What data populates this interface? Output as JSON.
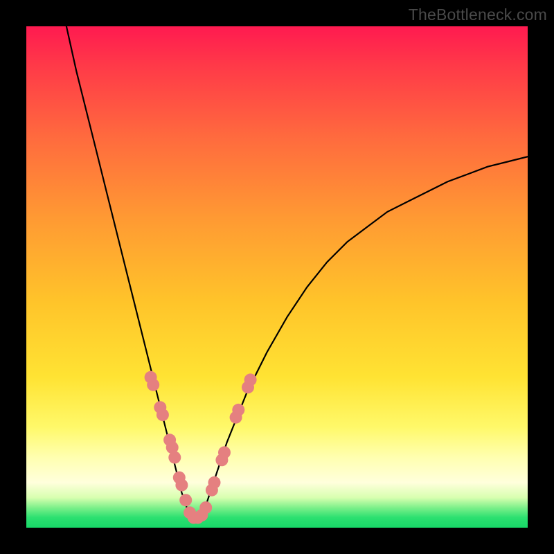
{
  "watermark": "TheBottleneck.com",
  "chart_data": {
    "type": "line",
    "title": "",
    "xlabel": "",
    "ylabel": "",
    "xlim": [
      0,
      100
    ],
    "ylim": [
      0,
      100
    ],
    "series": [
      {
        "name": "bottleneck-curve",
        "x": [
          8,
          10,
          12,
          14,
          16,
          18,
          20,
          22,
          24,
          26,
          28,
          30,
          31,
          32,
          33,
          34,
          36,
          38,
          40,
          44,
          48,
          52,
          56,
          60,
          64,
          68,
          72,
          76,
          80,
          84,
          88,
          92,
          96,
          100
        ],
        "values": [
          100,
          91,
          83,
          75,
          67,
          59,
          51,
          43,
          35,
          27,
          19,
          11,
          7,
          4,
          2,
          2,
          5,
          11,
          17,
          27,
          35,
          42,
          48,
          53,
          57,
          60,
          63,
          65,
          67,
          69,
          70.5,
          72,
          73,
          74
        ]
      }
    ],
    "markers": {
      "name": "highlight-dots",
      "color": "#e58080",
      "x": [
        24.8,
        25.3,
        26.7,
        27.2,
        28.6,
        29.1,
        29.6,
        30.5,
        31.0,
        31.8,
        32.6,
        33.4,
        34.2,
        35.0,
        35.8,
        37.0,
        37.5,
        39.0,
        39.5,
        41.8,
        42.3,
        44.2,
        44.7
      ],
      "values": [
        30,
        28.5,
        24,
        22.5,
        17.5,
        16.0,
        14,
        10,
        8.5,
        5.5,
        3,
        2,
        2,
        2.5,
        4,
        7.5,
        9,
        13.5,
        15,
        22,
        23.5,
        28,
        29.5
      ]
    },
    "gradient_stops": [
      {
        "pos": 0.0,
        "color": "#ff1a50"
      },
      {
        "pos": 0.38,
        "color": "#ff9933"
      },
      {
        "pos": 0.7,
        "color": "#ffe333"
      },
      {
        "pos": 0.91,
        "color": "#ffffdc"
      },
      {
        "pos": 1.0,
        "color": "#18d868"
      }
    ]
  }
}
